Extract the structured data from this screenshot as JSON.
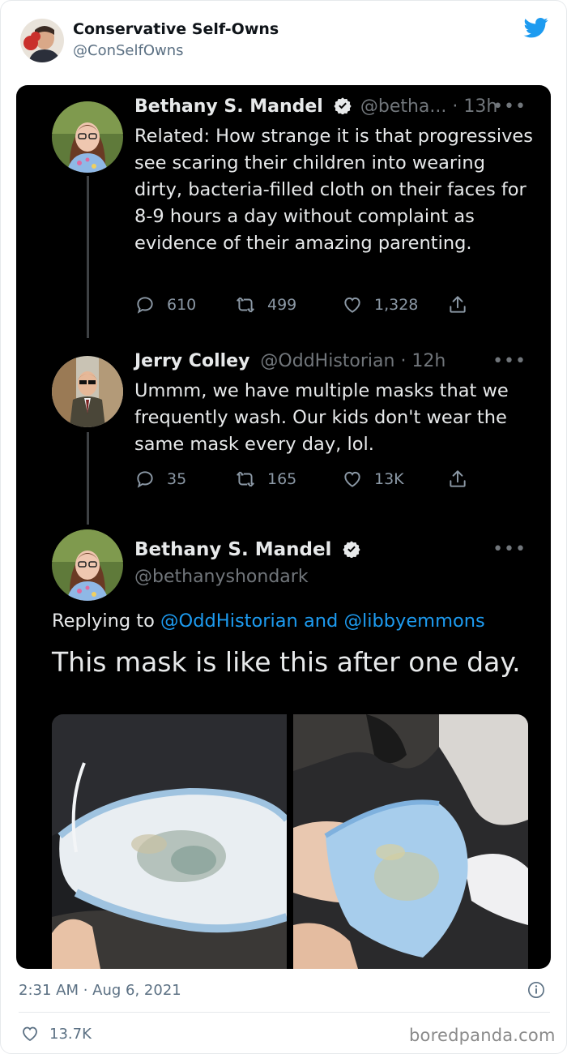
{
  "header": {
    "account_name": "Conservative Self-Owns",
    "account_handle": "@ConSelfOwns"
  },
  "thread": [
    {
      "name": "Bethany S. Mandel",
      "meta": "@betha... · 13h",
      "text": "Related: How strange it is that progressives see scaring their children into wearing dirty, bacteria-filled cloth on their faces for 8-9 hours a day without complaint as evidence of their amazing parenting.",
      "replies": "610",
      "retweets": "499",
      "likes": "1,328"
    },
    {
      "name": "Jerry Colley",
      "meta": "@OddHistorian · 12h",
      "text": "Ummm, we have multiple masks that we frequently wash. Our kids don't wear the same mask every day, lol.",
      "replies": "35",
      "retweets": "165",
      "likes": "13K"
    }
  ],
  "main_tweet": {
    "name": "Bethany S. Mandel",
    "handle": "@bethanyshondark",
    "replying_prefix": "Replying to",
    "replying_to": "@OddHistorian and @libbyemmons",
    "text": "This mask is like this after one day."
  },
  "footer": {
    "timestamp": "2:31 AM · Aug 6, 2021",
    "likes": "13.7K",
    "watermark": "boredpanda.com"
  },
  "icons": [
    "twitter-bird-icon",
    "verified-badge-icon",
    "more-dots-icon",
    "reply-icon",
    "retweet-icon",
    "like-icon",
    "share-icon",
    "info-icon",
    "heart-icon"
  ],
  "colors": {
    "twitter_blue": "#1d9bf0",
    "dark_bg": "#000000",
    "muted_text": "#71767b"
  }
}
